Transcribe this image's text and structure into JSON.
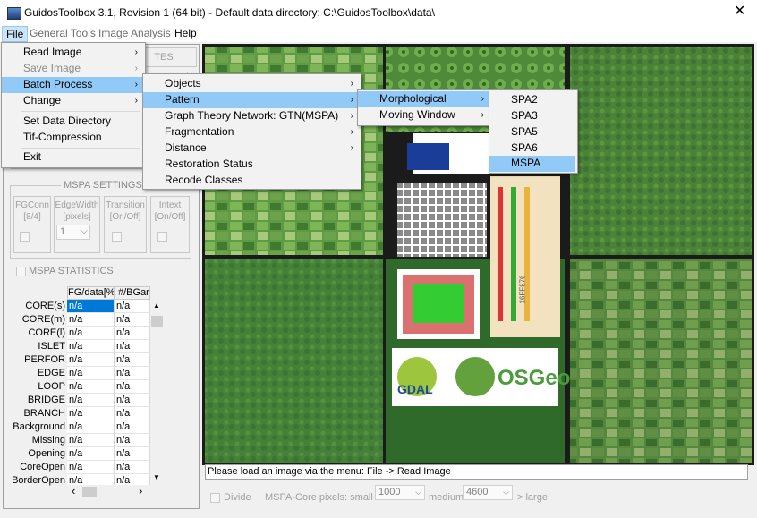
{
  "window": {
    "title": "GuidosToolbox 3.1, Revision 1 (64 bit) - Default data directory: C:\\GuidosToolbox\\data\\",
    "close_glyph": "✕"
  },
  "menubar": [
    "File",
    "General Tools",
    "Image Analysis",
    "Help"
  ],
  "file_menu": {
    "items": [
      {
        "label": "Read Image",
        "arrow": "›"
      },
      {
        "label": "Save Image",
        "arrow": "›"
      },
      {
        "label": "Batch Process",
        "arrow": "›"
      },
      {
        "label": "Change",
        "arrow": "›"
      },
      {
        "label": "Set Data Directory"
      },
      {
        "label": "Tif-Compression"
      },
      {
        "label": "Exit"
      }
    ]
  },
  "batch_menu": {
    "items": [
      {
        "label": "Objects",
        "arrow": "›"
      },
      {
        "label": "Pattern",
        "arrow": "›"
      },
      {
        "label": "Graph Theory Network: GTN(MSPA)",
        "arrow": "›"
      },
      {
        "label": "Fragmentation",
        "arrow": "›"
      },
      {
        "label": "Distance",
        "arrow": "›"
      },
      {
        "label": "Restoration Status"
      },
      {
        "label": "Recode Classes"
      }
    ]
  },
  "pattern_menu": {
    "items": [
      {
        "label": "Morphological",
        "arrow": "›"
      },
      {
        "label": "Moving Window",
        "arrow": "›"
      }
    ]
  },
  "morph_menu": {
    "items": [
      "SPA2",
      "SPA3",
      "SPA5",
      "SPA6",
      "MSPA"
    ]
  },
  "left_panel": {
    "hidden_tab_fragment": "TES",
    "mspa_settings": {
      "title": "MSPA SETTINGS",
      "params": [
        {
          "label": "FGConn",
          "value": "[8/4]"
        },
        {
          "label": "EdgeWidth",
          "value": "[pixels]"
        },
        {
          "label": "Transition",
          "value": "[On/Off]"
        },
        {
          "label": "Intext",
          "value": "[On/Off]"
        }
      ],
      "edgewidth_value": "1",
      "dropdown_glyph": "⌵"
    },
    "mspa_statistics": {
      "label": "MSPA STATISTICS",
      "columns": [
        "FG/data[%]",
        "#/BGare"
      ],
      "rows": [
        {
          "label": "CORE(s)",
          "v1": "n/a",
          "v2": "n/a"
        },
        {
          "label": "CORE(m)",
          "v1": "n/a",
          "v2": "n/a"
        },
        {
          "label": "CORE(l)",
          "v1": "n/a",
          "v2": "n/a"
        },
        {
          "label": "ISLET",
          "v1": "n/a",
          "v2": "n/a"
        },
        {
          "label": "PERFOR",
          "v1": "n/a",
          "v2": "n/a"
        },
        {
          "label": "EDGE",
          "v1": "n/a",
          "v2": "n/a"
        },
        {
          "label": "LOOP",
          "v1": "n/a",
          "v2": "n/a"
        },
        {
          "label": "BRIDGE",
          "v1": "n/a",
          "v2": "n/a"
        },
        {
          "label": "BRANCH",
          "v1": "n/a",
          "v2": "n/a"
        },
        {
          "label": "Background",
          "v1": "n/a",
          "v2": "n/a"
        },
        {
          "label": "Missing",
          "v1": "n/a",
          "v2": "n/a"
        },
        {
          "label": "Opening",
          "v1": "n/a",
          "v2": "n/a"
        },
        {
          "label": "CoreOpen",
          "v1": "n/a",
          "v2": "n/a"
        },
        {
          "label": "BorderOpen",
          "v1": "n/a",
          "v2": "n/a"
        }
      ],
      "scroll_up": "▲",
      "scroll_down": "▼",
      "scroll_left": "‹",
      "scroll_right": "›"
    }
  },
  "image_area": {
    "logo_gdal": "GDAL",
    "logo_osgeo": "OSGeo",
    "chip_text": "16FF876"
  },
  "status": "Please load an image via the menu: File -> Read Image",
  "bottom": {
    "divide_label": "Divide",
    "core_label": "MSPA-Core pixels:  small <",
    "small_value": "1000",
    "medium_label": "medium",
    "medium_value": "4600",
    "large_label": "> large"
  },
  "colors": {
    "accent": "#91c9f7",
    "selected_cell": "#0078d7",
    "menu_bg": "#f2f2f2"
  }
}
